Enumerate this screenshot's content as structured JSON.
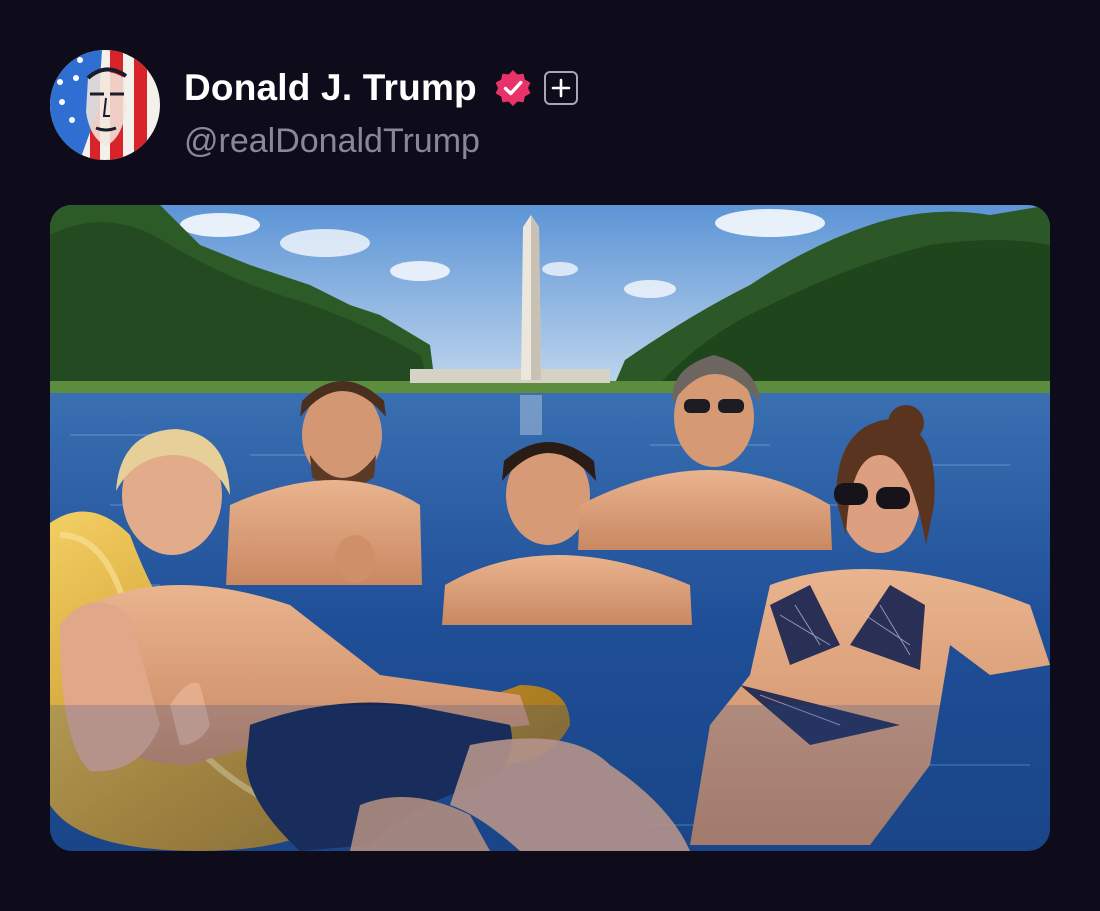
{
  "author": {
    "display_name": "Donald J. Trump",
    "handle": "@realDonaldTrump",
    "verified": true,
    "verified_badge_color": "#e8336a"
  },
  "icons": {
    "verified": "verified-badge-icon",
    "follow": "plus-icon",
    "avatar": "flag-portrait-avatar"
  },
  "colors": {
    "background": "#0e0c1a",
    "name_text": "#ffffff",
    "handle_text": "#8a8798",
    "follow_border": "#a9a6b6"
  },
  "media": {
    "type": "photo",
    "subject": "group-in-reflecting-pool-washington-monument"
  }
}
